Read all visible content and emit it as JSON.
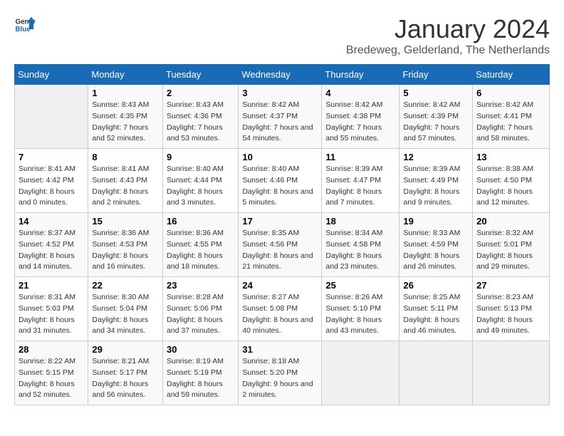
{
  "logo": {
    "text_general": "General",
    "text_blue": "Blue"
  },
  "title": "January 2024",
  "subtitle": "Bredeweg, Gelderland, The Netherlands",
  "days_of_week": [
    "Sunday",
    "Monday",
    "Tuesday",
    "Wednesday",
    "Thursday",
    "Friday",
    "Saturday"
  ],
  "weeks": [
    [
      {
        "day": "",
        "sunrise": "",
        "sunset": "",
        "daylight": "",
        "empty": true
      },
      {
        "day": "1",
        "sunrise": "Sunrise: 8:43 AM",
        "sunset": "Sunset: 4:35 PM",
        "daylight": "Daylight: 7 hours and 52 minutes."
      },
      {
        "day": "2",
        "sunrise": "Sunrise: 8:43 AM",
        "sunset": "Sunset: 4:36 PM",
        "daylight": "Daylight: 7 hours and 53 minutes."
      },
      {
        "day": "3",
        "sunrise": "Sunrise: 8:42 AM",
        "sunset": "Sunset: 4:37 PM",
        "daylight": "Daylight: 7 hours and 54 minutes."
      },
      {
        "day": "4",
        "sunrise": "Sunrise: 8:42 AM",
        "sunset": "Sunset: 4:38 PM",
        "daylight": "Daylight: 7 hours and 55 minutes."
      },
      {
        "day": "5",
        "sunrise": "Sunrise: 8:42 AM",
        "sunset": "Sunset: 4:39 PM",
        "daylight": "Daylight: 7 hours and 57 minutes."
      },
      {
        "day": "6",
        "sunrise": "Sunrise: 8:42 AM",
        "sunset": "Sunset: 4:41 PM",
        "daylight": "Daylight: 7 hours and 58 minutes."
      }
    ],
    [
      {
        "day": "7",
        "sunrise": "Sunrise: 8:41 AM",
        "sunset": "Sunset: 4:42 PM",
        "daylight": "Daylight: 8 hours and 0 minutes."
      },
      {
        "day": "8",
        "sunrise": "Sunrise: 8:41 AM",
        "sunset": "Sunset: 4:43 PM",
        "daylight": "Daylight: 8 hours and 2 minutes."
      },
      {
        "day": "9",
        "sunrise": "Sunrise: 8:40 AM",
        "sunset": "Sunset: 4:44 PM",
        "daylight": "Daylight: 8 hours and 3 minutes."
      },
      {
        "day": "10",
        "sunrise": "Sunrise: 8:40 AM",
        "sunset": "Sunset: 4:46 PM",
        "daylight": "Daylight: 8 hours and 5 minutes."
      },
      {
        "day": "11",
        "sunrise": "Sunrise: 8:39 AM",
        "sunset": "Sunset: 4:47 PM",
        "daylight": "Daylight: 8 hours and 7 minutes."
      },
      {
        "day": "12",
        "sunrise": "Sunrise: 8:39 AM",
        "sunset": "Sunset: 4:49 PM",
        "daylight": "Daylight: 8 hours and 9 minutes."
      },
      {
        "day": "13",
        "sunrise": "Sunrise: 8:38 AM",
        "sunset": "Sunset: 4:50 PM",
        "daylight": "Daylight: 8 hours and 12 minutes."
      }
    ],
    [
      {
        "day": "14",
        "sunrise": "Sunrise: 8:37 AM",
        "sunset": "Sunset: 4:52 PM",
        "daylight": "Daylight: 8 hours and 14 minutes."
      },
      {
        "day": "15",
        "sunrise": "Sunrise: 8:36 AM",
        "sunset": "Sunset: 4:53 PM",
        "daylight": "Daylight: 8 hours and 16 minutes."
      },
      {
        "day": "16",
        "sunrise": "Sunrise: 8:36 AM",
        "sunset": "Sunset: 4:55 PM",
        "daylight": "Daylight: 8 hours and 18 minutes."
      },
      {
        "day": "17",
        "sunrise": "Sunrise: 8:35 AM",
        "sunset": "Sunset: 4:56 PM",
        "daylight": "Daylight: 8 hours and 21 minutes."
      },
      {
        "day": "18",
        "sunrise": "Sunrise: 8:34 AM",
        "sunset": "Sunset: 4:58 PM",
        "daylight": "Daylight: 8 hours and 23 minutes."
      },
      {
        "day": "19",
        "sunrise": "Sunrise: 8:33 AM",
        "sunset": "Sunset: 4:59 PM",
        "daylight": "Daylight: 8 hours and 26 minutes."
      },
      {
        "day": "20",
        "sunrise": "Sunrise: 8:32 AM",
        "sunset": "Sunset: 5:01 PM",
        "daylight": "Daylight: 8 hours and 29 minutes."
      }
    ],
    [
      {
        "day": "21",
        "sunrise": "Sunrise: 8:31 AM",
        "sunset": "Sunset: 5:03 PM",
        "daylight": "Daylight: 8 hours and 31 minutes."
      },
      {
        "day": "22",
        "sunrise": "Sunrise: 8:30 AM",
        "sunset": "Sunset: 5:04 PM",
        "daylight": "Daylight: 8 hours and 34 minutes."
      },
      {
        "day": "23",
        "sunrise": "Sunrise: 8:28 AM",
        "sunset": "Sunset: 5:06 PM",
        "daylight": "Daylight: 8 hours and 37 minutes."
      },
      {
        "day": "24",
        "sunrise": "Sunrise: 8:27 AM",
        "sunset": "Sunset: 5:08 PM",
        "daylight": "Daylight: 8 hours and 40 minutes."
      },
      {
        "day": "25",
        "sunrise": "Sunrise: 8:26 AM",
        "sunset": "Sunset: 5:10 PM",
        "daylight": "Daylight: 8 hours and 43 minutes."
      },
      {
        "day": "26",
        "sunrise": "Sunrise: 8:25 AM",
        "sunset": "Sunset: 5:11 PM",
        "daylight": "Daylight: 8 hours and 46 minutes."
      },
      {
        "day": "27",
        "sunrise": "Sunrise: 8:23 AM",
        "sunset": "Sunset: 5:13 PM",
        "daylight": "Daylight: 8 hours and 49 minutes."
      }
    ],
    [
      {
        "day": "28",
        "sunrise": "Sunrise: 8:22 AM",
        "sunset": "Sunset: 5:15 PM",
        "daylight": "Daylight: 8 hours and 52 minutes."
      },
      {
        "day": "29",
        "sunrise": "Sunrise: 8:21 AM",
        "sunset": "Sunset: 5:17 PM",
        "daylight": "Daylight: 8 hours and 56 minutes."
      },
      {
        "day": "30",
        "sunrise": "Sunrise: 8:19 AM",
        "sunset": "Sunset: 5:19 PM",
        "daylight": "Daylight: 8 hours and 59 minutes."
      },
      {
        "day": "31",
        "sunrise": "Sunrise: 8:18 AM",
        "sunset": "Sunset: 5:20 PM",
        "daylight": "Daylight: 9 hours and 2 minutes."
      },
      {
        "day": "",
        "sunrise": "",
        "sunset": "",
        "daylight": "",
        "empty": true
      },
      {
        "day": "",
        "sunrise": "",
        "sunset": "",
        "daylight": "",
        "empty": true
      },
      {
        "day": "",
        "sunrise": "",
        "sunset": "",
        "daylight": "",
        "empty": true
      }
    ]
  ]
}
